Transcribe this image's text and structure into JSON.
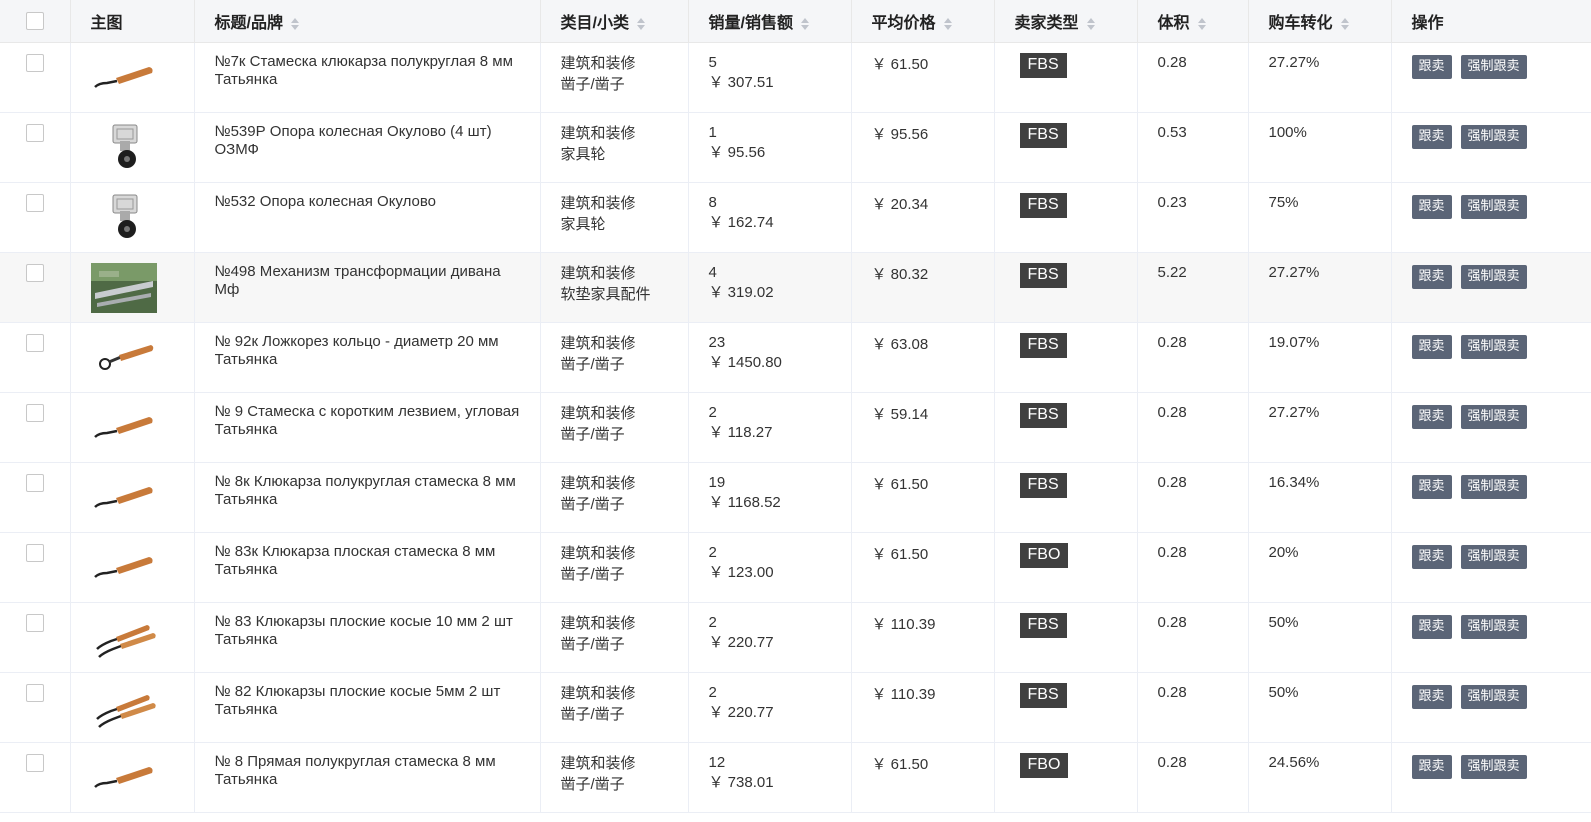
{
  "columns": {
    "main_image": "主图",
    "title_brand": "标题/品牌",
    "category": "类目/小类",
    "sales": "销量/销售额",
    "avg_price": "平均价格",
    "seller_type": "卖家类型",
    "volume": "体积",
    "cart_conversion": "购车转化",
    "actions": "操作"
  },
  "actions": {
    "follow": "跟卖",
    "force_follow": "强制跟卖"
  },
  "icons": {
    "sort": "sort-caret-icon",
    "thumbnails": [
      "chisel-icon",
      "caster-wheel-icon",
      "caster-wheel-icon",
      "sofa-mechanism-photo",
      "spoon-knife-icon",
      "chisel-icon",
      "chisel-icon",
      "chisel-icon",
      "double-chisel-icon",
      "double-chisel-icon",
      "chisel-icon"
    ]
  },
  "colors": {
    "header_bg": "#f5f6f8",
    "badge_bg": "#404040",
    "button_bg": "#5b6577",
    "highlight_row": "#f7f7f7"
  },
  "rows": [
    {
      "title": "№7к Стамеска клюкарза полукруглая 8 мм",
      "brand": "Татьянка",
      "cat1": "建筑和装修",
      "cat2": "凿子/凿子",
      "qty": "5",
      "amount": "￥ 307.51",
      "price": "￥ 61.50",
      "seller": "FBS",
      "volume": "0.28",
      "conv": "27.27%"
    },
    {
      "title": "№539Р Опора колесная Окулово (4 шт)",
      "brand": "ОЗМФ",
      "cat1": "建筑和装修",
      "cat2": "家具轮",
      "qty": "1",
      "amount": "￥ 95.56",
      "price": "￥ 95.56",
      "seller": "FBS",
      "volume": "0.53",
      "conv": "100%"
    },
    {
      "title": "№532 Опора колесная Окулово",
      "brand": "",
      "cat1": "建筑和装修",
      "cat2": "家具轮",
      "qty": "8",
      "amount": "￥ 162.74",
      "price": "￥ 20.34",
      "seller": "FBS",
      "volume": "0.23",
      "conv": "75%"
    },
    {
      "title": "№498 Механизм трансформации дивана",
      "brand": "Мф",
      "cat1": "建筑和装修",
      "cat2": "软垫家具配件",
      "qty": "4",
      "amount": "￥ 319.02",
      "price": "￥ 80.32",
      "seller": "FBS",
      "volume": "5.22",
      "conv": "27.27%"
    },
    {
      "title": "№ 92к Ложкорез кольцо - диаметр 20 мм",
      "brand": "Татьянка",
      "cat1": "建筑和装修",
      "cat2": "凿子/凿子",
      "qty": "23",
      "amount": "￥ 1450.80",
      "price": "￥ 63.08",
      "seller": "FBS",
      "volume": "0.28",
      "conv": "19.07%"
    },
    {
      "title": "№ 9 Стамеска с коротким лезвием, угловая",
      "brand": "Татьянка",
      "cat1": "建筑和装修",
      "cat2": "凿子/凿子",
      "qty": "2",
      "amount": "￥ 118.27",
      "price": "￥ 59.14",
      "seller": "FBS",
      "volume": "0.28",
      "conv": "27.27%"
    },
    {
      "title": "№ 8к Клюкарза полукруглая стамеска 8 мм",
      "brand": "Татьянка",
      "cat1": "建筑和装修",
      "cat2": "凿子/凿子",
      "qty": "19",
      "amount": "￥ 1168.52",
      "price": "￥ 61.50",
      "seller": "FBS",
      "volume": "0.28",
      "conv": "16.34%"
    },
    {
      "title": "№ 83к Клюкарза плоская стамеска 8 мм",
      "brand": "Татьянка",
      "cat1": "建筑和装修",
      "cat2": "凿子/凿子",
      "qty": "2",
      "amount": "￥ 123.00",
      "price": "￥ 61.50",
      "seller": "FBO",
      "volume": "0.28",
      "conv": "20%"
    },
    {
      "title": "№ 83 Клюкарзы плоские косые 10 мм 2 шт",
      "brand": "Татьянка",
      "cat1": "建筑和装修",
      "cat2": "凿子/凿子",
      "qty": "2",
      "amount": "￥ 220.77",
      "price": "￥ 110.39",
      "seller": "FBS",
      "volume": "0.28",
      "conv": "50%"
    },
    {
      "title": "№ 82 Клюкарзы плоские косые 5мм 2 шт",
      "brand": "Татьянка",
      "cat1": "建筑和装修",
      "cat2": "凿子/凿子",
      "qty": "2",
      "amount": "￥ 220.77",
      "price": "￥ 110.39",
      "seller": "FBS",
      "volume": "0.28",
      "conv": "50%"
    },
    {
      "title": "№ 8 Прямая полукруглая стамеска 8 мм",
      "brand": "Татьянка",
      "cat1": "建筑和装修",
      "cat2": "凿子/凿子",
      "qty": "12",
      "amount": "￥ 738.01",
      "price": "￥ 61.50",
      "seller": "FBO",
      "volume": "0.28",
      "conv": "24.56%"
    }
  ]
}
